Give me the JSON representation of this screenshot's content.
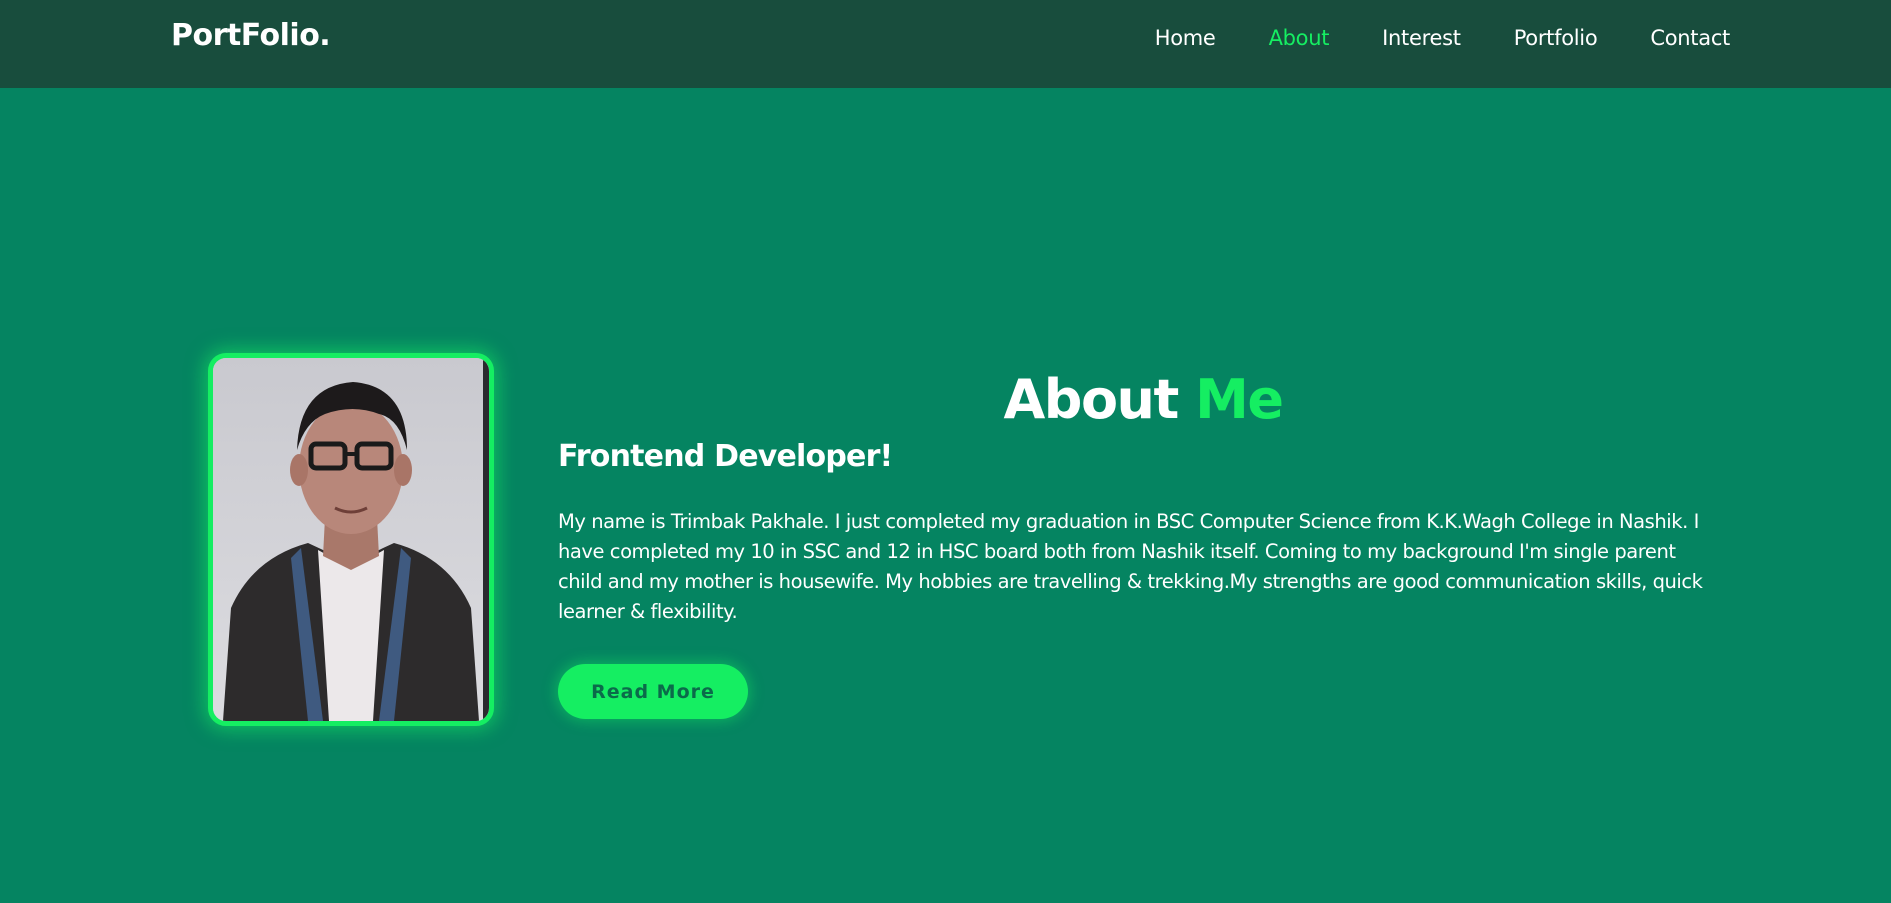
{
  "header": {
    "logo": "PortFolio.",
    "nav": [
      {
        "label": "Home"
      },
      {
        "label": "About"
      },
      {
        "label": "Interest"
      },
      {
        "label": "Portfolio"
      },
      {
        "label": "Contact"
      }
    ],
    "active_nav": "About"
  },
  "about": {
    "title_main": "About ",
    "title_accent": "Me",
    "subtitle": "Frontend Developer!",
    "bio": "My name is Trimbak Pakhale. I just completed my graduation in BSC Computer Science from K.K.Wagh College in Nashik. I have completed my 10 in SSC and 12 in HSC board both from Nashik itself. Coming to my background I'm single parent child and my mother is housewife. My hobbies are travelling & trekking.My strengths are good communication skills, quick learner & flexibility.",
    "button_label": "Read More",
    "photo": "profile-photo"
  },
  "colors": {
    "background": "#058461",
    "header": "#184d3d",
    "accent": "#15ee62",
    "text": "#ffffff"
  }
}
